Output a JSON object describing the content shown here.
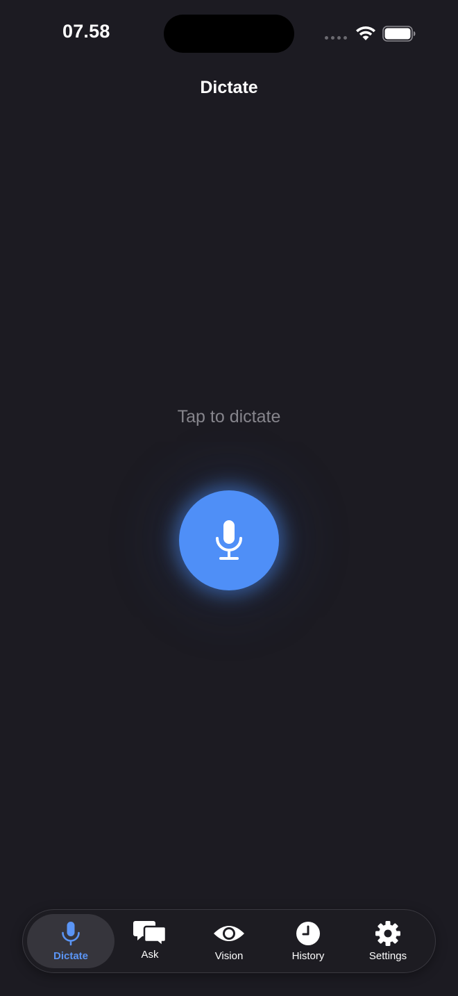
{
  "status_bar": {
    "time": "07.58",
    "icons": [
      "signal-dots-icon",
      "wifi-icon",
      "battery-icon"
    ]
  },
  "header": {
    "title": "Dictate"
  },
  "main": {
    "hint": "Tap to dictate",
    "mic_button_icon": "microphone-icon"
  },
  "tab_bar": {
    "active_tab": "Dictate",
    "tabs": [
      {
        "label": "Dictate",
        "icon": "microphone-icon"
      },
      {
        "label": "Ask",
        "icon": "chat-bubbles-icon"
      },
      {
        "label": "Vision",
        "icon": "eye-icon"
      },
      {
        "label": "History",
        "icon": "clock-icon"
      },
      {
        "label": "Settings",
        "icon": "gear-icon"
      }
    ]
  },
  "colors": {
    "background": "#1c1b22",
    "accent": "#4f8ff7",
    "active_tab_label": "#5b95f5",
    "hint_text": "#86858c"
  }
}
